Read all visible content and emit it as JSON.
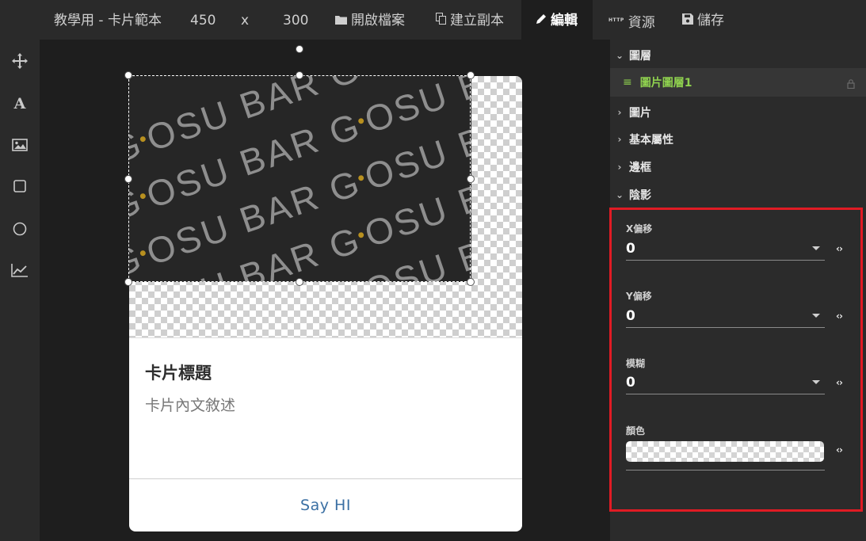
{
  "topbar": {
    "doc_title": "教學用 - 卡片範本",
    "width": "450",
    "times": "x",
    "height": "300",
    "open": {
      "label": "開啟檔案",
      "icon": "folder-icon"
    },
    "copy": {
      "label": "建立副本",
      "icon": "copy-icon"
    },
    "edit": {
      "label": "編輯",
      "icon": "pencil-icon"
    },
    "resources": {
      "label": "資源",
      "icon_text": "HTTP"
    },
    "save": {
      "label": "儲存",
      "icon": "save-icon"
    }
  },
  "toolbar": [
    "move-tool",
    "text-tool",
    "image-tool",
    "rectangle-tool",
    "circle-tool",
    "chart-tool"
  ],
  "card": {
    "logo_words": "GOSU BAR",
    "title": "卡片標題",
    "text": "卡片內文敘述",
    "button": "Say HI"
  },
  "panel": {
    "layers": {
      "title": "圖層",
      "item": "圖片圖層1"
    },
    "image": "圖片",
    "basic": "基本屬性",
    "border": "邊框",
    "shadow": {
      "title": "陰影",
      "x_offset": {
        "label": "X偏移",
        "value": "0"
      },
      "y_offset": {
        "label": "Y偏移",
        "value": "0"
      },
      "blur": {
        "label": "模糊",
        "value": "0"
      },
      "color": {
        "label": "顏色"
      }
    }
  },
  "colors": {
    "accent_green": "#8fd14f",
    "highlight_red": "#e01b24",
    "button_blue": "#3a6fa3"
  }
}
